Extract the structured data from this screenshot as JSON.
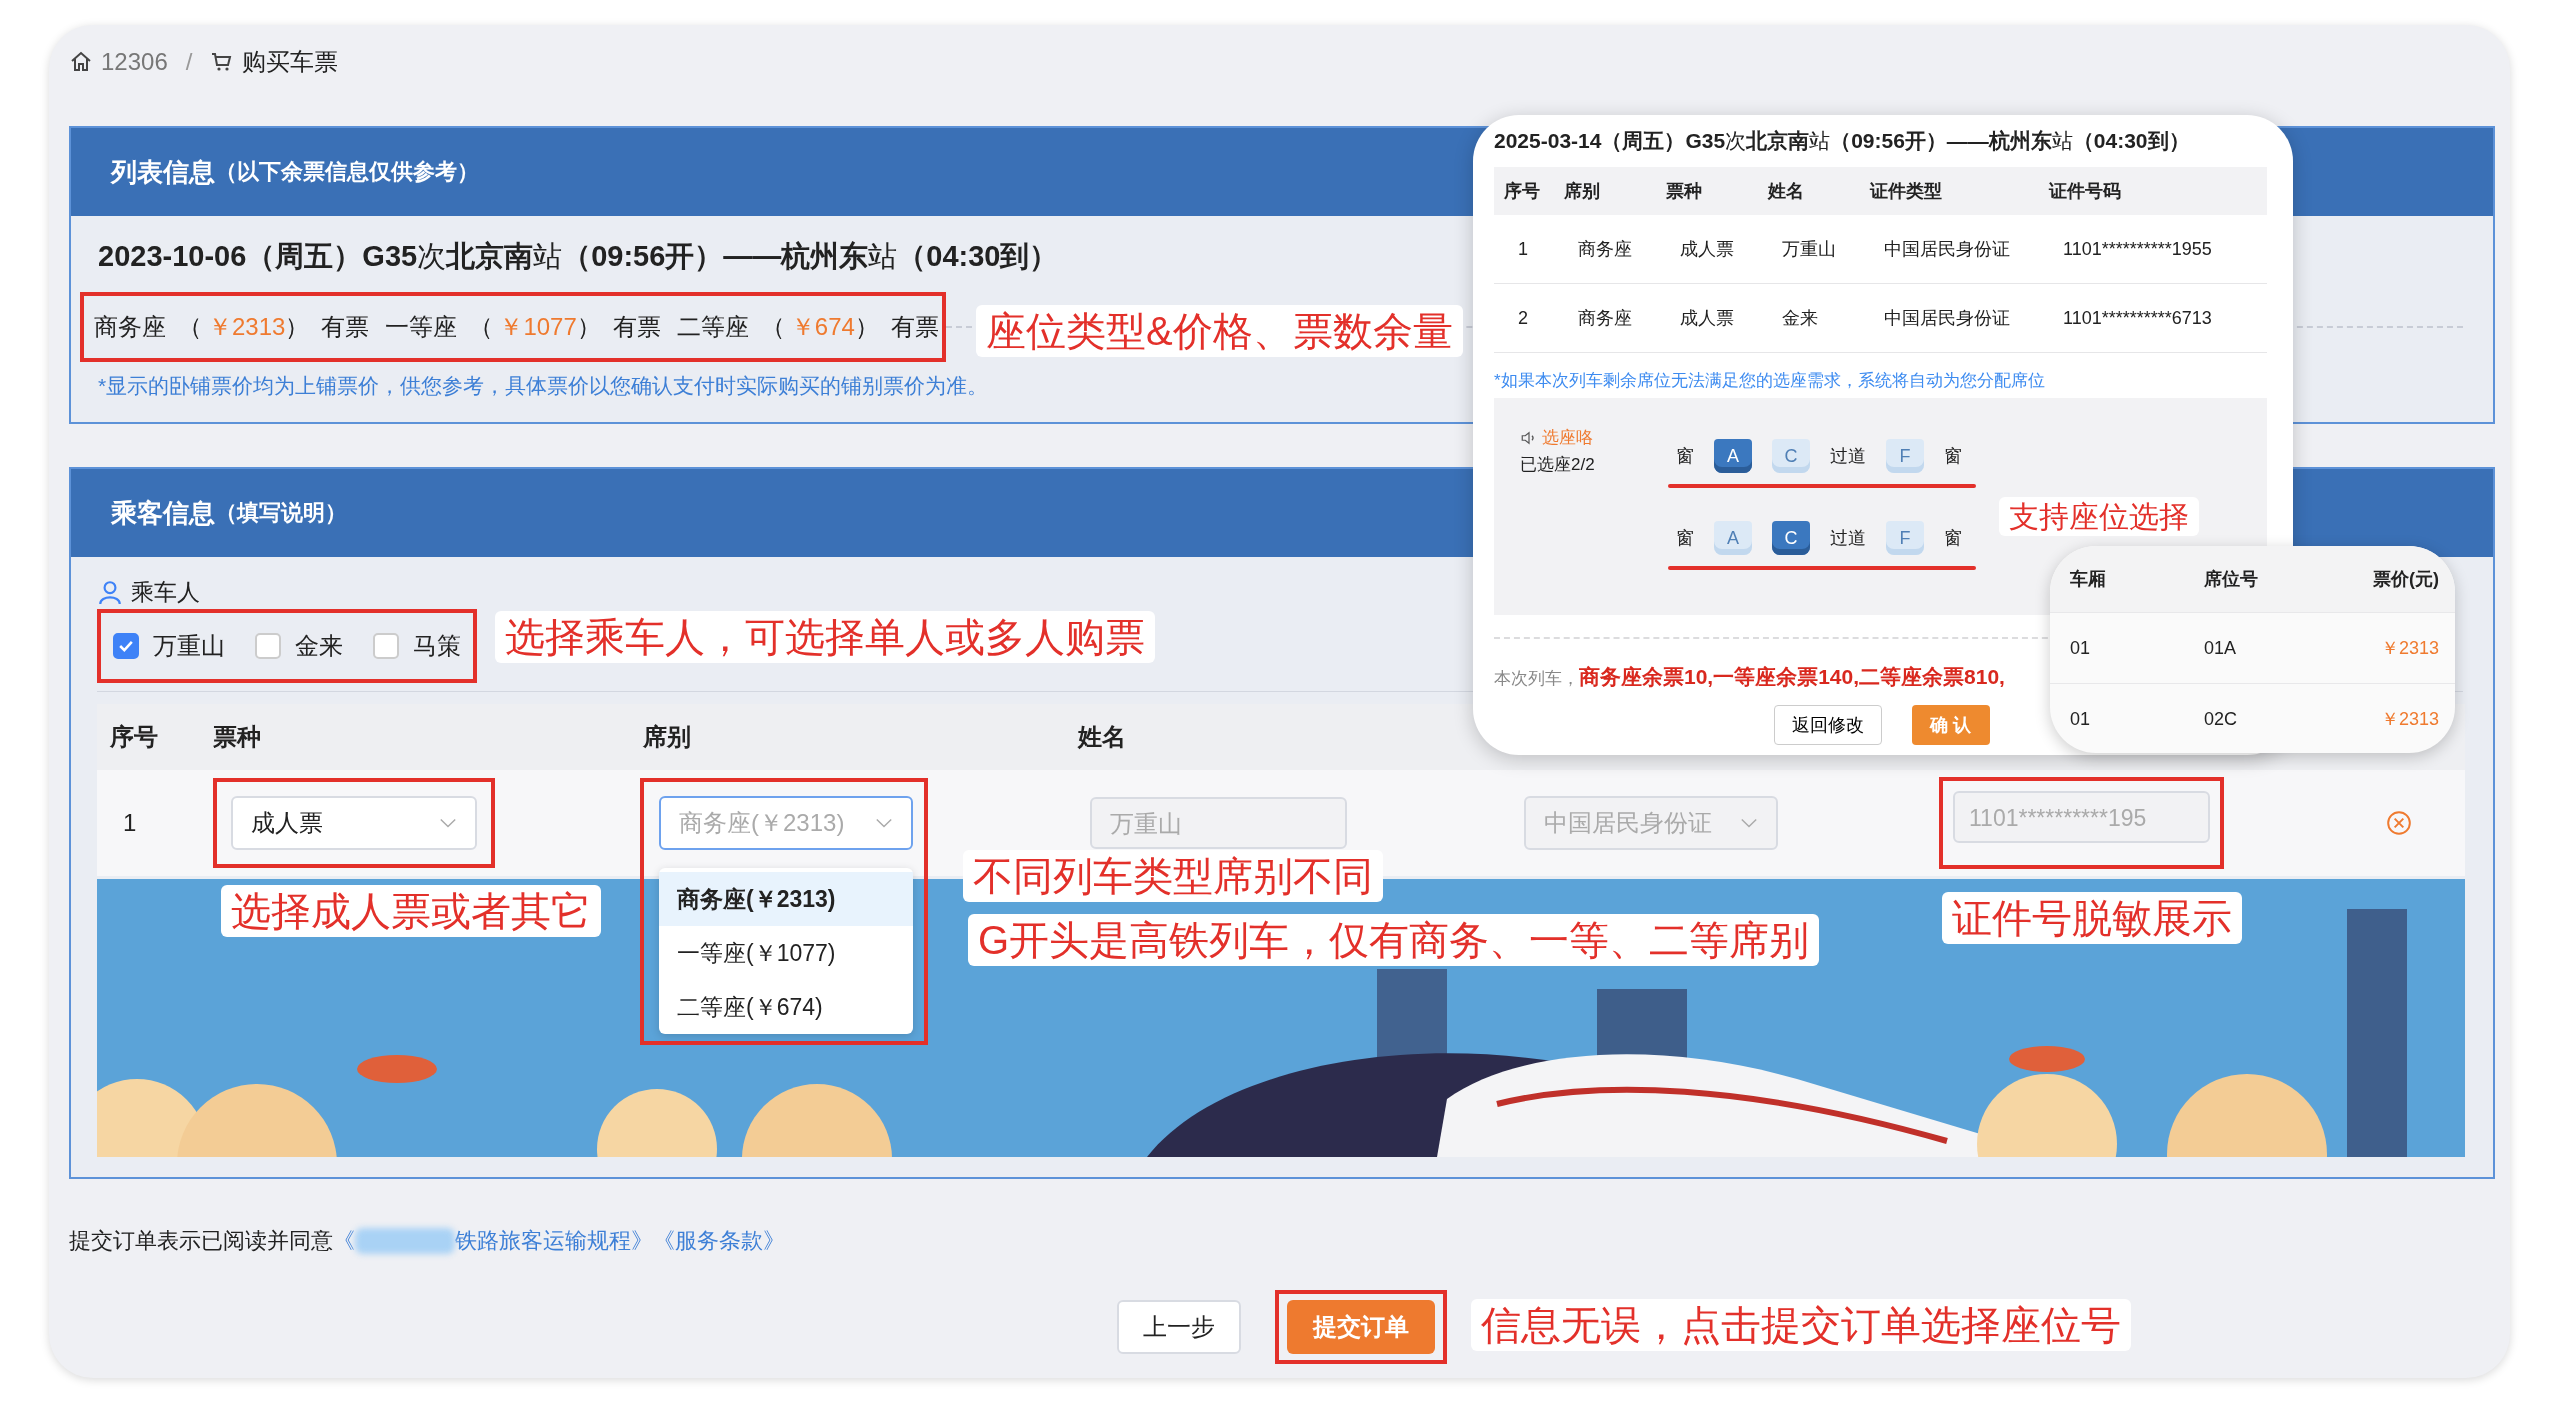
{
  "breadcrumb": [
    {
      "kind": "home",
      "label": "12306"
    },
    {
      "kind": "cart",
      "label": "购买车票"
    }
  ],
  "breadcrumb_separator": "/",
  "train_panel": {
    "title": "列表信息",
    "subtitle": "（以下余票信息仅供参考）",
    "train": "**2023-10-06（周五）G35**次**北京南**站**（09:56开）——杭州东**站**（04:30到）**",
    "seats": [
      {
        "name": "商务座",
        "open": "（",
        "price": "￥2313",
        "close": "）",
        "status": "有票"
      },
      {
        "name": "一等座",
        "open": "（",
        "price": "￥1077",
        "close": "）",
        "status": "有票"
      },
      {
        "name": "二等座",
        "open": "（",
        "price": "￥674",
        "close": "）",
        "status": "有票"
      }
    ],
    "note": "*显示的卧铺票价均为上铺票价，供您参考，具体票价以您确认支付时实际购买的铺别票价为准。"
  },
  "passenger_panel": {
    "title": "乘客信息",
    "subtitle": "（填写说明）",
    "passenger_label": "乘车人",
    "passengers": [
      {
        "name": "万重山",
        "checked": true
      },
      {
        "name": "金来",
        "checked": false
      },
      {
        "name": "马策",
        "checked": false
      }
    ],
    "columns": [
      "序号",
      "票种",
      "席别",
      "姓名"
    ],
    "row": {
      "index": "1",
      "ticket_type": "成人票",
      "seat_class": "商务座(￥2313)",
      "name": "万重山",
      "id_type": "中国居民身份证",
      "id_number": "1101**********195"
    },
    "seat_options": [
      {
        "label": "商务座(￥2313)",
        "selected": true
      },
      {
        "label": "一等座(￥1077)",
        "selected": false
      },
      {
        "label": "二等座(￥674)",
        "selected": false
      }
    ]
  },
  "agreement": {
    "text": "提交订单表示已阅读并同意",
    "links": [
      {
        "before": "《",
        "redacted": true,
        "after": "铁路旅客运输规程》"
      },
      {
        "before": "《服务条款》",
        "redacted": false
      }
    ]
  },
  "buttons": [
    {
      "label": "上一步",
      "kind": "secondary"
    },
    {
      "label": "提交订单",
      "kind": "primary"
    }
  ],
  "confirm_dialog": {
    "title": "**2025-03-14（周五）G35**次**北京南**站**（09:56开）——杭州东**站**（04:30到）**",
    "columns": [
      "序号",
      "席别",
      "票种",
      "姓名",
      "证件类型",
      "证件号码"
    ],
    "rows": [
      [
        "1",
        "商务座",
        "成人票",
        "万重山",
        "中国居民身份证",
        "1101**********1955"
      ],
      [
        "2",
        "商务座",
        "成人票",
        "金来",
        "中国居民身份证",
        "1101**********6713"
      ]
    ],
    "note": "*如果本次列车剩余席位无法满足您的选座需求，系统将自动为您分配席位",
    "seat_picker": {
      "hint": "选座咯",
      "count": "已选座2/2",
      "rows": [
        [
          {
            "kind": "label",
            "text": "窗"
          },
          {
            "kind": "seat",
            "text": "A",
            "selected": true
          },
          {
            "kind": "seat",
            "text": "C",
            "selected": false
          },
          {
            "kind": "label",
            "text": "过道"
          },
          {
            "kind": "seat",
            "text": "F",
            "selected": false
          },
          {
            "kind": "label",
            "text": "窗"
          }
        ],
        [
          {
            "kind": "label",
            "text": "窗"
          },
          {
            "kind": "seat",
            "text": "A",
            "selected": false
          },
          {
            "kind": "seat",
            "text": "C",
            "selected": true
          },
          {
            "kind": "label",
            "text": "过道"
          },
          {
            "kind": "seat",
            "text": "F",
            "selected": false
          },
          {
            "kind": "label",
            "text": "窗"
          }
        ]
      ]
    },
    "remaining_prefix": "本次列车，",
    "remaining": "商务座余票10,一等座余票140,二等座余票810,",
    "buttons": [
      {
        "label": "返回修改",
        "kind": "secondary"
      },
      {
        "label": "确 认",
        "kind": "primary"
      }
    ]
  },
  "seat_result": {
    "columns": [
      "车厢",
      "席位号",
      "票价(元)"
    ],
    "rows": [
      [
        "01",
        "01A",
        "￥2313"
      ],
      [
        "01",
        "02C",
        "￥2313"
      ]
    ]
  },
  "annotations": [
    {
      "text": "座位类型&价格、票数余量"
    },
    {
      "text": "支持座位选择"
    },
    {
      "text": "选择乘车人，可选择单人或多人购票"
    },
    {
      "text": "不同列车类型席别不同"
    },
    {
      "text": "选择成人票或者其它"
    },
    {
      "text": "证件号脱敏展示"
    },
    {
      "text": "G开头是高铁列车，仅有商务、一等、二等席别"
    },
    {
      "text": "信息无误，点击提交订单选择座位号"
    }
  ]
}
